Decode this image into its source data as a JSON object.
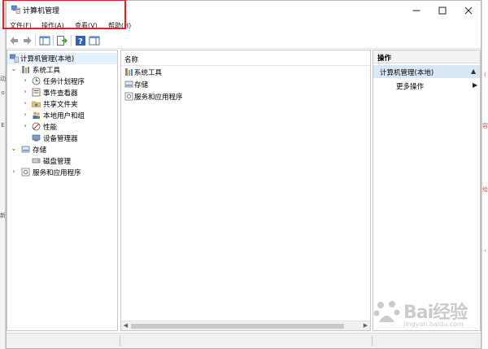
{
  "window": {
    "title": "计算机管理"
  },
  "menu": {
    "items": [
      "文件(F)",
      "操作(A)",
      "查看(V)",
      "帮助(H)"
    ]
  },
  "tree": {
    "root": "计算机管理(本地)",
    "items": [
      {
        "label": "系统工具",
        "expanded": true,
        "level": 1
      },
      {
        "label": "任务计划程序",
        "level": 2
      },
      {
        "label": "事件查看器",
        "level": 2
      },
      {
        "label": "共享文件夹",
        "level": 2
      },
      {
        "label": "本地用户和组",
        "level": 2
      },
      {
        "label": "性能",
        "level": 2
      },
      {
        "label": "设备管理器",
        "level": 2
      },
      {
        "label": "存储",
        "expanded": true,
        "level": 1
      },
      {
        "label": "磁盘管理",
        "level": 2
      },
      {
        "label": "服务和应用程序",
        "level": 1
      }
    ]
  },
  "center": {
    "column_header": "名称",
    "rows": [
      "系统工具",
      "存储",
      "服务和应用程序"
    ]
  },
  "actions": {
    "header": "操作",
    "section": "计算机管理(本地)",
    "items": [
      "更多操作"
    ]
  },
  "colors": {
    "highlight_border": "#e0212b",
    "selection": "#d9e6f4"
  }
}
